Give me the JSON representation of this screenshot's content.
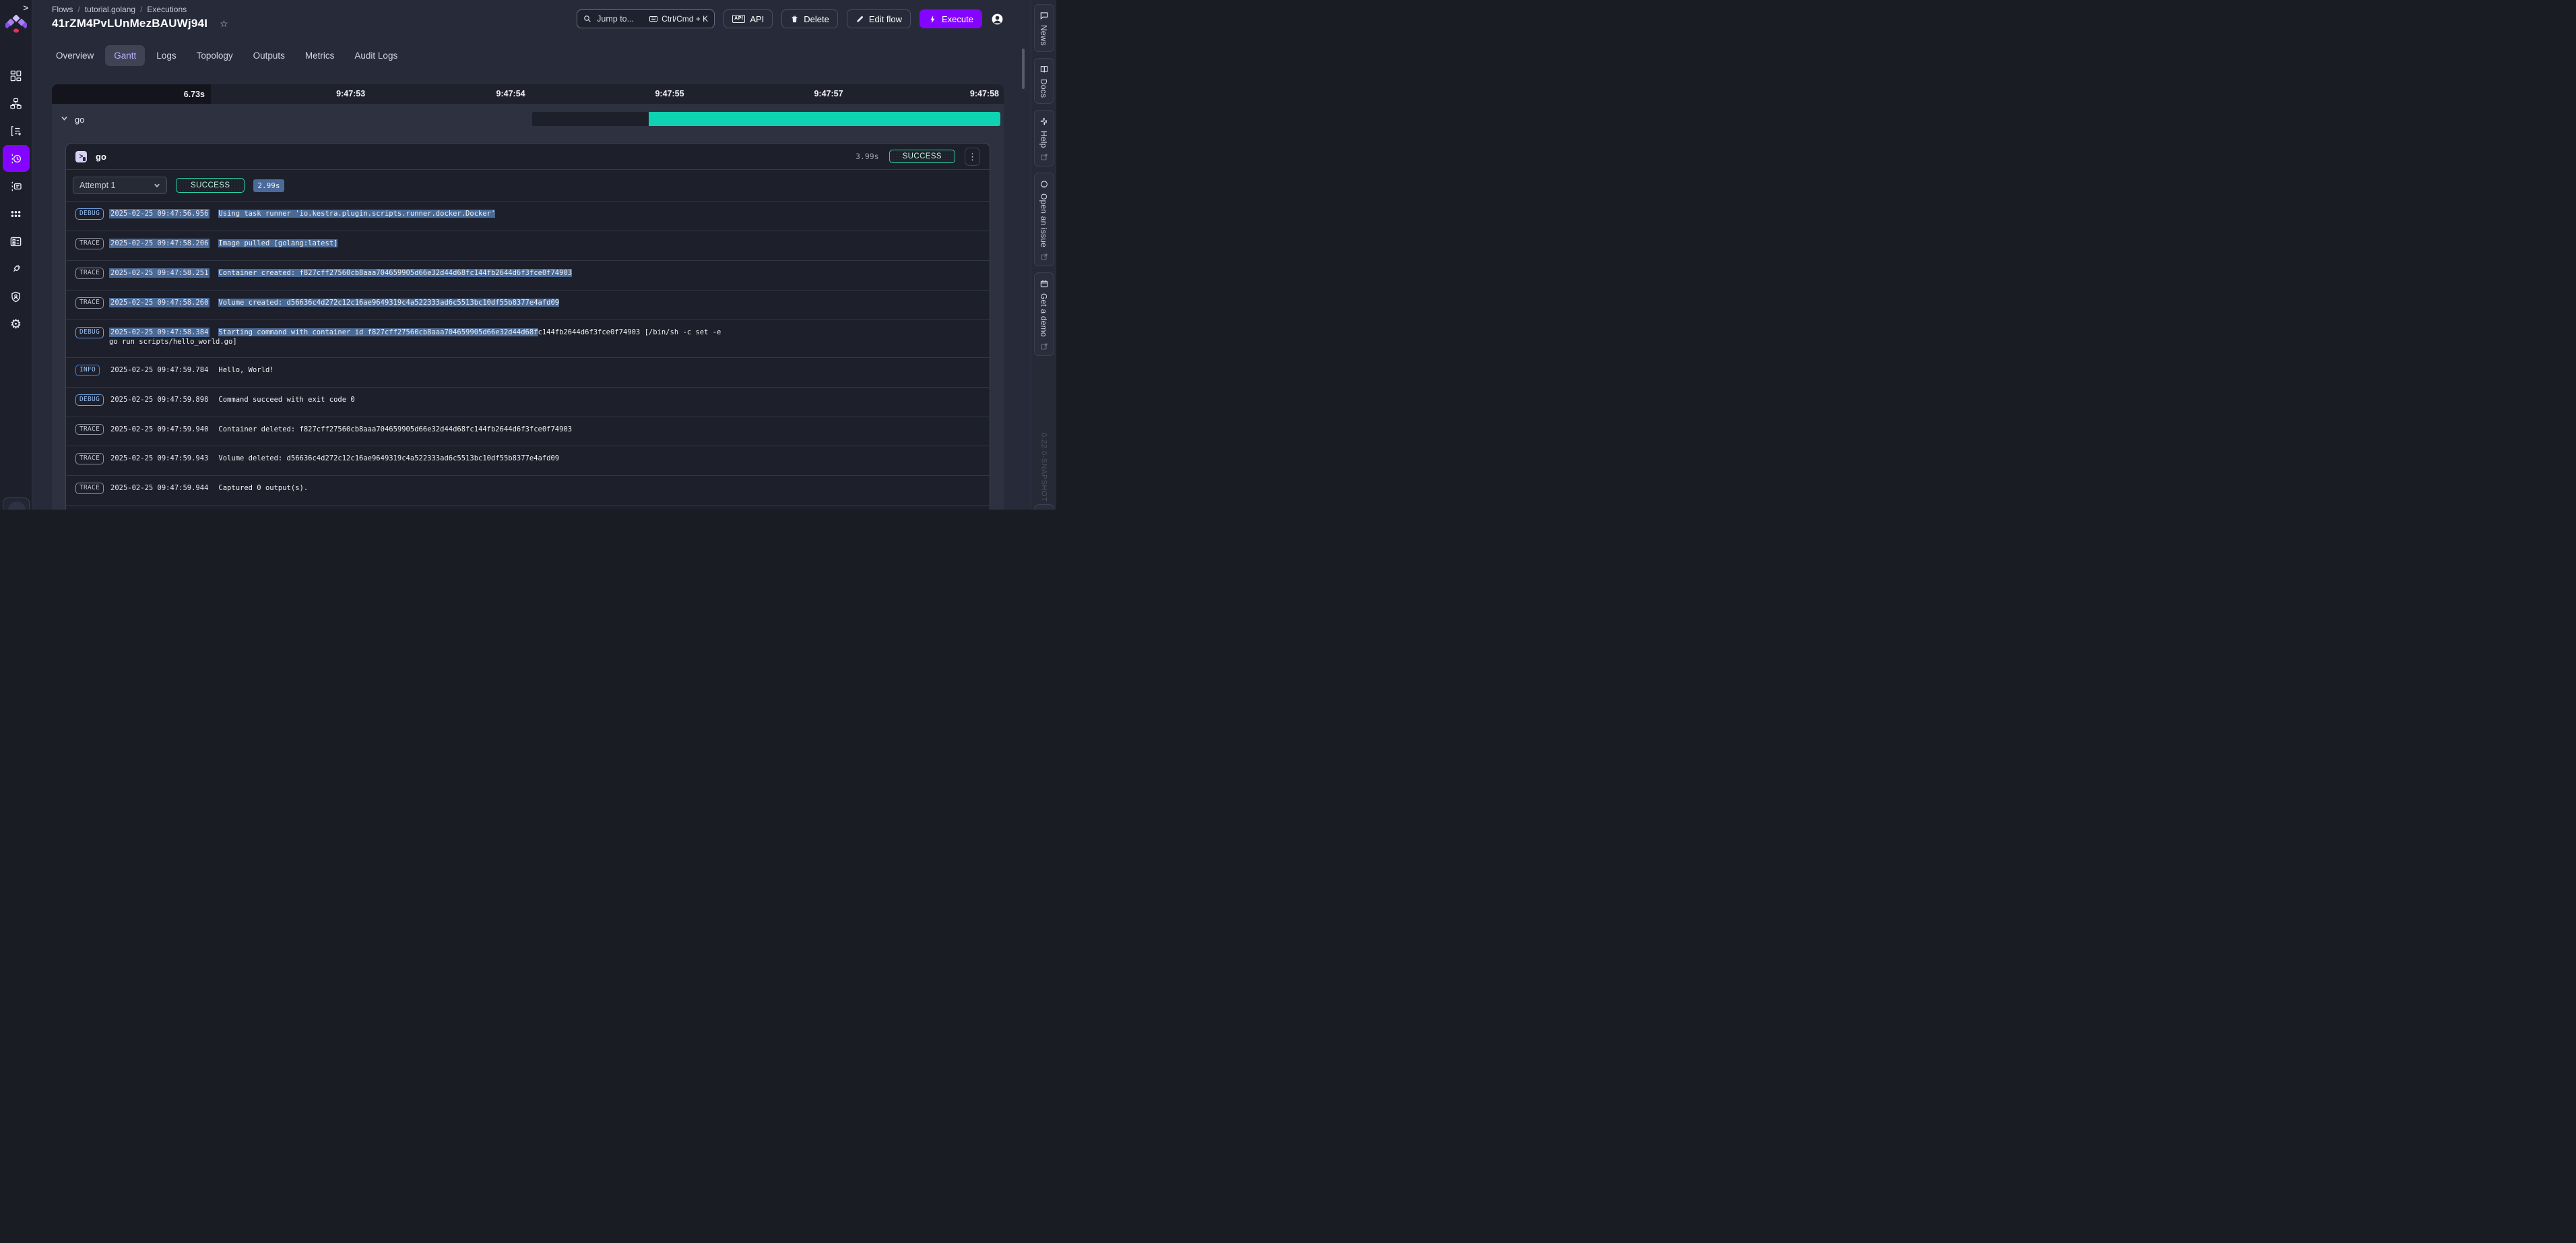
{
  "colors": {
    "accent_purple": "#8405FF",
    "success_green": "#2BD3A2",
    "gantt_bar_green": "#0ED2B2",
    "gantt_bar_waiting": "#1D202A",
    "selection_blue": "#4A6A96",
    "active_tab_text": "#B6AEFB"
  },
  "sidebar": {
    "expand_label": ">",
    "items": [
      {
        "name": "dashboard",
        "icon": "view-dashboard",
        "active": false
      },
      {
        "name": "flows",
        "icon": "flows",
        "active": false
      },
      {
        "name": "editor",
        "icon": "flow-editor",
        "active": false
      },
      {
        "name": "executions",
        "icon": "executions",
        "active": true
      },
      {
        "name": "logs",
        "icon": "logs",
        "active": false
      },
      {
        "name": "apps",
        "icon": "apps",
        "active": false
      },
      {
        "name": "blueprints",
        "icon": "blueprints",
        "active": false
      },
      {
        "name": "plugins",
        "icon": "plugins",
        "active": false
      },
      {
        "name": "security",
        "icon": "security",
        "active": false
      },
      {
        "name": "settings",
        "icon": "settings",
        "active": false
      }
    ]
  },
  "header": {
    "breadcrumb": [
      "Flows",
      "tutorial.golang",
      "Executions"
    ],
    "title": "41rZM4PvLUnMezBAUWj94I",
    "star_icon": "star-outline",
    "search": {
      "placeholder": "Jump to...",
      "shortcut": "Ctrl/Cmd + K"
    },
    "actions": [
      {
        "label": "API",
        "icon": "api",
        "primary": false
      },
      {
        "label": "Delete",
        "icon": "trash",
        "primary": false
      },
      {
        "label": "Edit flow",
        "icon": "pencil",
        "primary": false
      },
      {
        "label": "Execute",
        "icon": "bolt",
        "primary": true
      }
    ]
  },
  "tabs": {
    "items": [
      {
        "label": "Overview",
        "active": false
      },
      {
        "label": "Gantt",
        "active": true
      },
      {
        "label": "Logs",
        "active": false
      },
      {
        "label": "Topology",
        "active": false
      },
      {
        "label": "Outputs",
        "active": false
      },
      {
        "label": "Metrics",
        "active": false
      },
      {
        "label": "Audit Logs",
        "active": false
      }
    ]
  },
  "gantt": {
    "total_duration": "6.73s",
    "ticks": [
      "9:47:53",
      "9:47:54",
      "9:47:55",
      "9:47:57",
      "9:47:58"
    ],
    "row": {
      "task": "go",
      "segments": [
        {
          "state": "WAITING",
          "color": "#1D202A"
        },
        {
          "state": "SUCCESS",
          "color": "#0ED2B2"
        }
      ]
    }
  },
  "task_card": {
    "name": "go",
    "duration": "3.99s",
    "state": "SUCCESS",
    "attempt": {
      "label": "Attempt 1",
      "state": "SUCCESS",
      "duration": "2.99s"
    }
  },
  "logs": [
    {
      "level": "DEBUG",
      "ts": "2025-02-25 09:47:56.956",
      "ts_selected": true,
      "parts": [
        {
          "text": "Using task runner 'io.kestra.plugin.scripts.runner.docker.Docker'",
          "selected": true
        }
      ]
    },
    {
      "level": "TRACE",
      "ts": "2025-02-25 09:47:58.206",
      "ts_selected": true,
      "parts": [
        {
          "text": "Image pulled [golang:latest]",
          "selected": true
        }
      ]
    },
    {
      "level": "TRACE",
      "ts": "2025-02-25 09:47:58.251",
      "ts_selected": true,
      "parts": [
        {
          "text": "Container created: f827cff27560cb8aaa704659905d66e32d44d68fc144fb2644d6f3fce0f74903",
          "selected": true
        }
      ]
    },
    {
      "level": "TRACE",
      "ts": "2025-02-25 09:47:58.260",
      "ts_selected": true,
      "parts": [
        {
          "text": "Volume created: d56636c4d272c12c16ae9649319c4a522333ad6c5513bc10df55b8377e4afd09",
          "selected": true
        }
      ]
    },
    {
      "level": "DEBUG",
      "ts": "2025-02-25 09:47:58.384",
      "ts_selected": true,
      "parts": [
        {
          "text": "Starting command with container id f827cff27560cb8aaa704659905d66e32d44d68f",
          "selected": true
        },
        {
          "text": "c144fb2644d6f3fce0f74903 [/bin/sh -c set -e\ngo run scripts/hello_world.go]",
          "selected": false
        }
      ]
    },
    {
      "level": "INFO",
      "ts": "2025-02-25 09:47:59.784",
      "ts_selected": false,
      "parts": [
        {
          "text": "Hello, World!",
          "selected": false
        }
      ]
    },
    {
      "level": "DEBUG",
      "ts": "2025-02-25 09:47:59.898",
      "ts_selected": false,
      "parts": [
        {
          "text": "Command succeed with exit code 0",
          "selected": false
        }
      ]
    },
    {
      "level": "TRACE",
      "ts": "2025-02-25 09:47:59.940",
      "ts_selected": false,
      "parts": [
        {
          "text": "Container deleted: f827cff27560cb8aaa704659905d66e32d44d68fc144fb2644d6f3fce0f74903",
          "selected": false
        }
      ]
    },
    {
      "level": "TRACE",
      "ts": "2025-02-25 09:47:59.943",
      "ts_selected": false,
      "parts": [
        {
          "text": "Volume deleted: d56636c4d272c12c16ae9649319c4a522333ad6c5513bc10df55b8377e4afd09",
          "selected": false
        }
      ]
    },
    {
      "level": "TRACE",
      "ts": "2025-02-25 09:47:59.944",
      "ts_selected": false,
      "parts": [
        {
          "text": "Captured 0 output(s).",
          "selected": false
        }
      ]
    }
  ],
  "right_rail": {
    "items": [
      {
        "label": "News",
        "icon": "chat",
        "external": false
      },
      {
        "label": "Docs",
        "icon": "book",
        "external": false
      },
      {
        "label": "Help",
        "icon": "slack",
        "external": true
      },
      {
        "label": "Open an issue",
        "icon": "github",
        "external": true
      },
      {
        "label": "Get a demo",
        "icon": "calendar",
        "external": true
      }
    ],
    "version": "0.22.0-SNAPSHOT"
  }
}
